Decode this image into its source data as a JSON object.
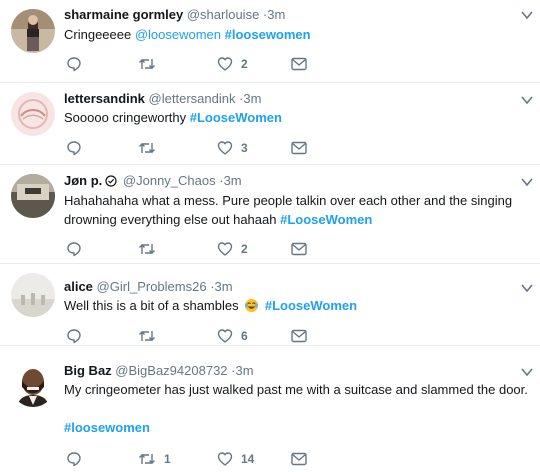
{
  "tweets": [
    {
      "name": "sharmaine gormley",
      "handle": "@sharlouise",
      "time": "3m",
      "text_plain": "Cringeeeee ",
      "mention": "@loosewomen",
      "hashtag": "#loosewomen",
      "replies": "",
      "retweets": "",
      "likes": "2"
    },
    {
      "name": "lettersandink",
      "handle": "@lettersandink",
      "time": "3m",
      "text_plain": "Sooooo cringeworthy ",
      "hashtag": "#LooseWomen",
      "replies": "",
      "retweets": "",
      "likes": "3"
    },
    {
      "name": "Jøn p.",
      "handle": "@Jonny_Chaos",
      "time": "3m",
      "text_plain": "Hahahahaha what a mess. Pure people talkin over each other and the singing drowning everything else out hahaah ",
      "hashtag": "#LooseWomen",
      "replies": "",
      "retweets": "",
      "likes": "2"
    },
    {
      "name": "alice",
      "handle": "@Girl_Problems26",
      "time": "3m",
      "text_plain": "Well this is a bit of a shambles ",
      "emoji": "face-with-tears-of-joy",
      "hashtag": "#LooseWomen",
      "replies": "",
      "retweets": "",
      "likes": "6"
    },
    {
      "name": "Big Baz",
      "handle": "@BigBaz94208732",
      "time": "3m",
      "text_plain": "My cringeometer has just walked past me with a suitcase and slammed the door.",
      "hashtag": "#loosewomen",
      "replies": "",
      "retweets": "1",
      "likes": "14"
    }
  ],
  "separator": "·",
  "colors": {
    "link": "#1da1f2",
    "muted": "#657786",
    "text": "#14171a",
    "divider": "#e6ecf0"
  },
  "icons": [
    "reply-icon",
    "retweet-icon",
    "like-icon",
    "dm-icon",
    "chevron-down-icon",
    "verified-circle-icon"
  ]
}
